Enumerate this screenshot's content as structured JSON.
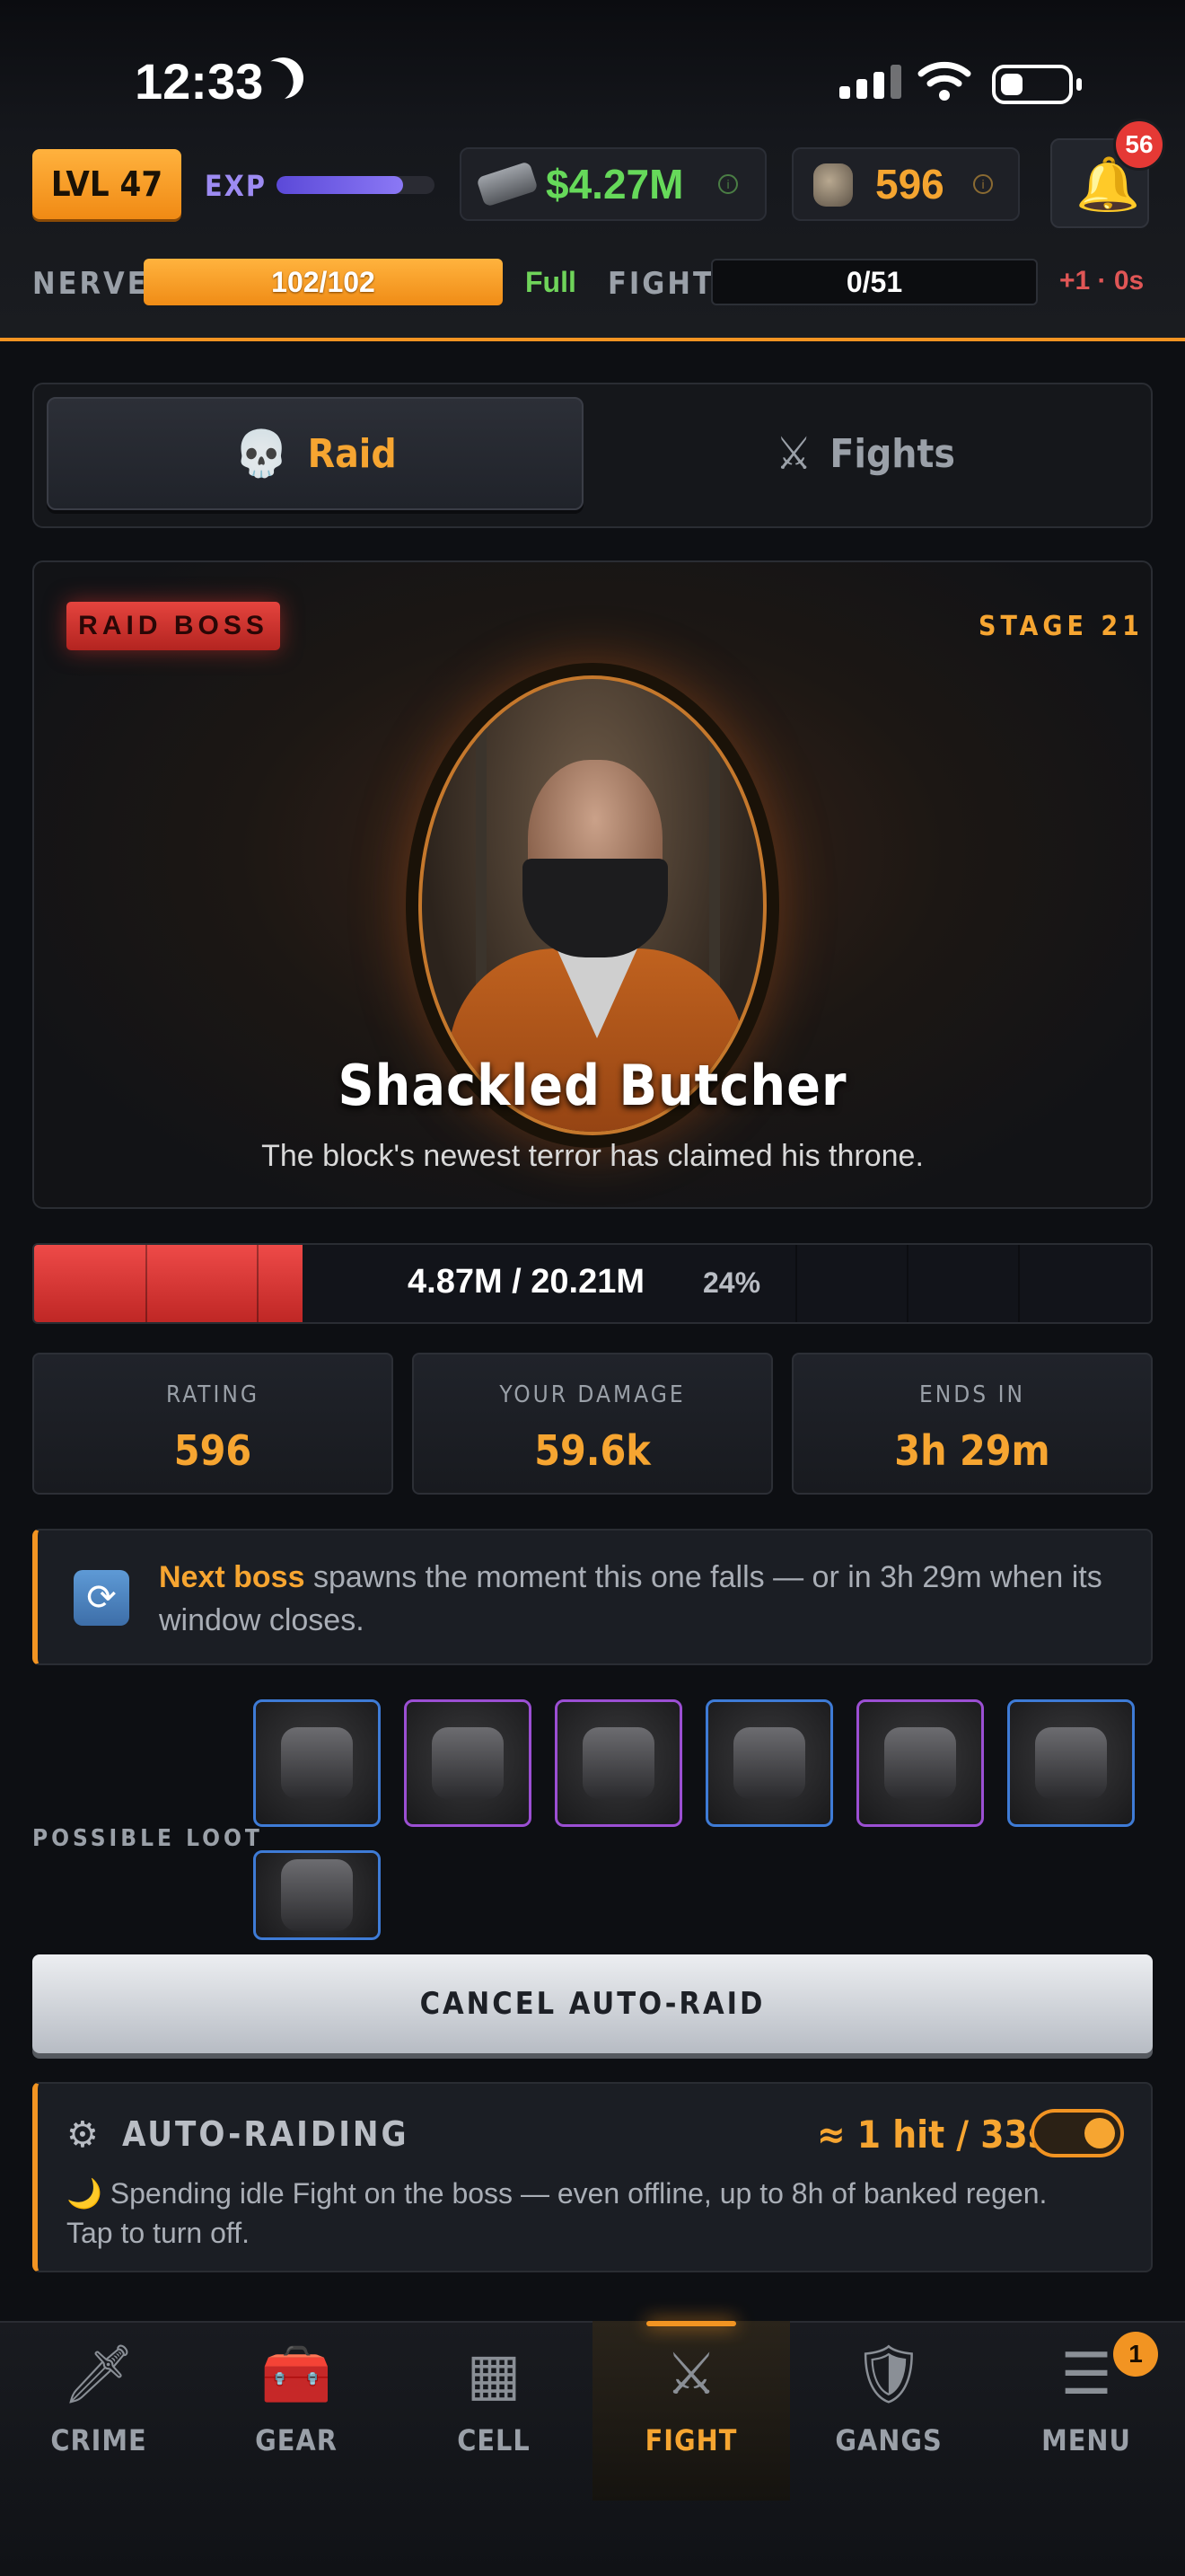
{
  "status_bar": {
    "time": "12:33"
  },
  "header": {
    "level": "LVL 47",
    "exp_label": "EXP",
    "exp_progress": 0.8,
    "money": "$4.27M",
    "rating": "596",
    "notifications": "56",
    "nerve_label": "NERVE",
    "nerve_value": "102/102",
    "nerve_status": "Full",
    "fight_label": "FIGHT",
    "fight_value": "0/51",
    "fight_regen": "+1 · 0s",
    "info_glyph": "i"
  },
  "tabs": [
    {
      "label": "Raid",
      "icon": "skull-icon",
      "active": true
    },
    {
      "label": "Fights",
      "icon": "crossed-swords-icon",
      "active": false
    }
  ],
  "boss": {
    "badge": "RAID BOSS",
    "stage": "STAGE 21",
    "name": "Shackled Butcher",
    "description": "The block's newest terror has claimed his throne.",
    "hp_text": "4.87M / 20.21M",
    "hp_percent": "24%",
    "hp_fraction": 0.24
  },
  "stats": [
    {
      "label": "RATING",
      "value": "596"
    },
    {
      "label": "YOUR DAMAGE",
      "value": "59.6k"
    },
    {
      "label": "ENDS IN",
      "value": "3h 29m"
    }
  ],
  "notice": {
    "highlight": "Next boss",
    "text": " spawns the moment this one falls — or in 3h 29m when its window closes."
  },
  "loot": {
    "label": "POSSIBLE LOOT",
    "items": [
      {
        "name": "helmet-icon",
        "rarity": "rare"
      },
      {
        "name": "boots-icon",
        "rarity": "epic"
      },
      {
        "name": "body-armor-icon",
        "rarity": "epic"
      },
      {
        "name": "boots-icon",
        "rarity": "rare"
      },
      {
        "name": "wrist-gadget-icon",
        "rarity": "epic"
      },
      {
        "name": "pliers-icon",
        "rarity": "rare"
      },
      {
        "name": "boots-icon",
        "rarity": "rare"
      }
    ]
  },
  "cancel_button": "CANCEL AUTO-RAID",
  "auto_raid": {
    "title": "AUTO-RAIDING",
    "rate": "≈ 1 hit / 33s",
    "enabled": true,
    "description": "🌙 Spending idle Fight on the boss — even offline, up to 8h of banked regen. Tap to turn off."
  },
  "nav": [
    {
      "label": "CRIME",
      "icon": "knife-icon",
      "glyph": "🗡",
      "active": false
    },
    {
      "label": "GEAR",
      "icon": "chest-icon",
      "glyph": "🧰",
      "active": false
    },
    {
      "label": "CELL",
      "icon": "cell-icon",
      "glyph": "▦",
      "active": false
    },
    {
      "label": "FIGHT",
      "icon": "swords-icon",
      "glyph": "⚔",
      "active": true
    },
    {
      "label": "GANGS",
      "icon": "shield-icon",
      "glyph": "🛡",
      "active": false
    },
    {
      "label": "MENU",
      "icon": "menu-icon",
      "glyph": "☰",
      "active": false
    }
  ],
  "menu_badge": "1",
  "colors": {
    "accent": "#f29422",
    "money": "#66d95a",
    "hp": "#e5443e",
    "exp": "#8b78f5"
  }
}
